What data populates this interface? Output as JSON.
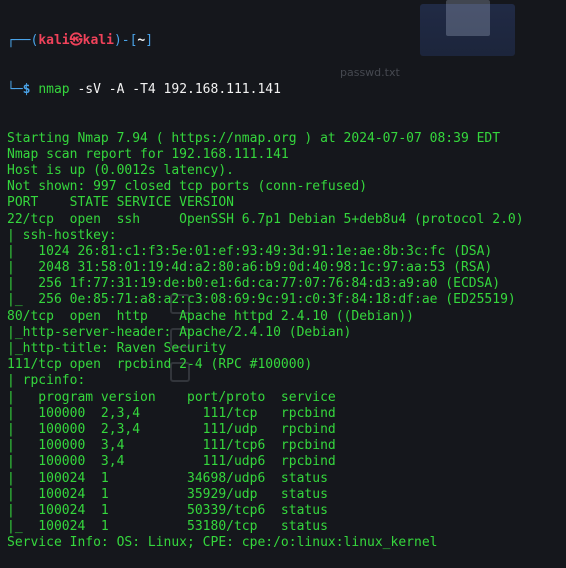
{
  "prompt": {
    "frame_start": "┌──(",
    "user": "kali㉿kali",
    "frame_mid": ")-[",
    "cwd": "~",
    "frame_end": "]",
    "line2_frame": "└─",
    "symbol": "$",
    "command_name": "nmap",
    "command_args": " -sV -A -T4 192.168.111.141"
  },
  "output": [
    "Starting Nmap 7.94 ( https://nmap.org ) at 2024-07-07 08:39 EDT",
    "Nmap scan report for 192.168.111.141",
    "Host is up (0.0012s latency).",
    "Not shown: 997 closed tcp ports (conn-refused)",
    "PORT    STATE SERVICE VERSION",
    "22/tcp  open  ssh     OpenSSH 6.7p1 Debian 5+deb8u4 (protocol 2.0)",
    "| ssh-hostkey:",
    "|   1024 26:81:c1:f3:5e:01:ef:93:49:3d:91:1e:ae:8b:3c:fc (DSA)",
    "|   2048 31:58:01:19:4d:a2:80:a6:b9:0d:40:98:1c:97:aa:53 (RSA)",
    "|   256 1f:77:31:19:de:b0:e1:6d:ca:77:07:76:84:d3:a9:a0 (ECDSA)",
    "|_  256 0e:85:71:a8:a2:c3:08:69:9c:91:c0:3f:84:18:df:ae (ED25519)",
    "80/tcp  open  http    Apache httpd 2.4.10 ((Debian))",
    "|_http-server-header: Apache/2.4.10 (Debian)",
    "|_http-title: Raven Security",
    "111/tcp open  rpcbind 2-4 (RPC #100000)",
    "| rpcinfo:",
    "|   program version    port/proto  service",
    "|   100000  2,3,4        111/tcp   rpcbind",
    "|   100000  2,3,4        111/udp   rpcbind",
    "|   100000  3,4          111/tcp6  rpcbind",
    "|   100000  3,4          111/udp6  rpcbind",
    "|   100024  1          34698/udp6  status",
    "|   100024  1          35929/udp   status",
    "|   100024  1          50339/tcp6  status",
    "|_  100024  1          53180/tcp   status",
    "Service Info: OS: Linux; CPE: cpe:/o:linux:linux_kernel"
  ],
  "background": {
    "desktop_label": "passwd.txt"
  },
  "colors": {
    "background": "#15171c",
    "output_green": "#35d73d",
    "prompt_blue": "#4aa3e8",
    "user_red": "#f0425a",
    "text_white": "#f2f2f2"
  }
}
